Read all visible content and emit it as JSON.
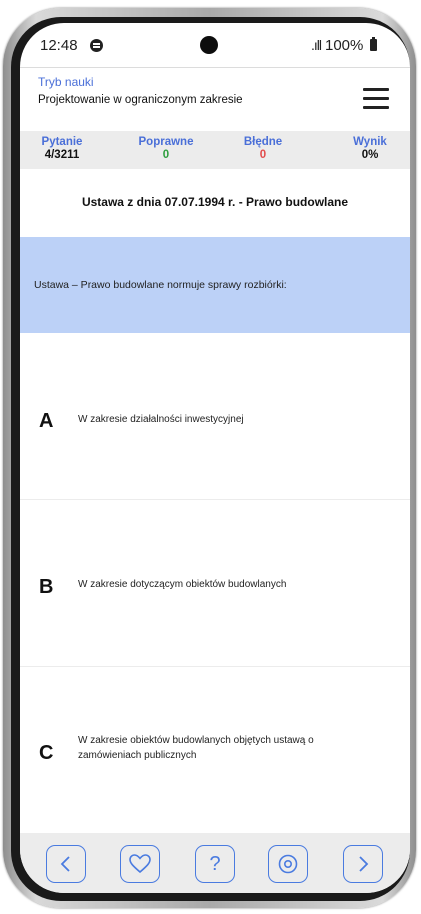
{
  "status": {
    "time": "12:48",
    "signal": ".ıll",
    "battery": "100%"
  },
  "header": {
    "mode": "Tryb nauki",
    "course": "Projektowanie w ograniczonym zakresie"
  },
  "stats": [
    {
      "label": "Pytanie",
      "value": "4/3211",
      "color": "#111111"
    },
    {
      "label": "Poprawne",
      "value": "0",
      "color": "#2e9e3e"
    },
    {
      "label": "Błędne",
      "value": "0",
      "color": "#e24b4b"
    },
    {
      "label": "Wynik",
      "value": "0%",
      "color": "#111111"
    }
  ],
  "law_title": "Ustawa z dnia 07.07.1994 r. - Prawo budowlane",
  "question": "Ustawa – Prawo budowlane normuje sprawy rozbiórki:",
  "answers": [
    {
      "letter": "A",
      "text": "W zakresie działalności inwestycyjnej"
    },
    {
      "letter": "B",
      "text": "W zakresie dotyczącym obiektów budowlanych"
    },
    {
      "letter": "C",
      "text": "W zakresie obiektów budowlanych objętych ustawą o zamówieniach publicznych"
    }
  ],
  "nav": {
    "prev": "chevron-left-icon",
    "favorite": "heart-icon",
    "help": "?",
    "preview": "eye-icon",
    "next": "chevron-right-icon"
  },
  "colors": {
    "accent": "#4a7be0",
    "question_bg": "#bcd1f7",
    "nav_bg": "#ececec"
  }
}
